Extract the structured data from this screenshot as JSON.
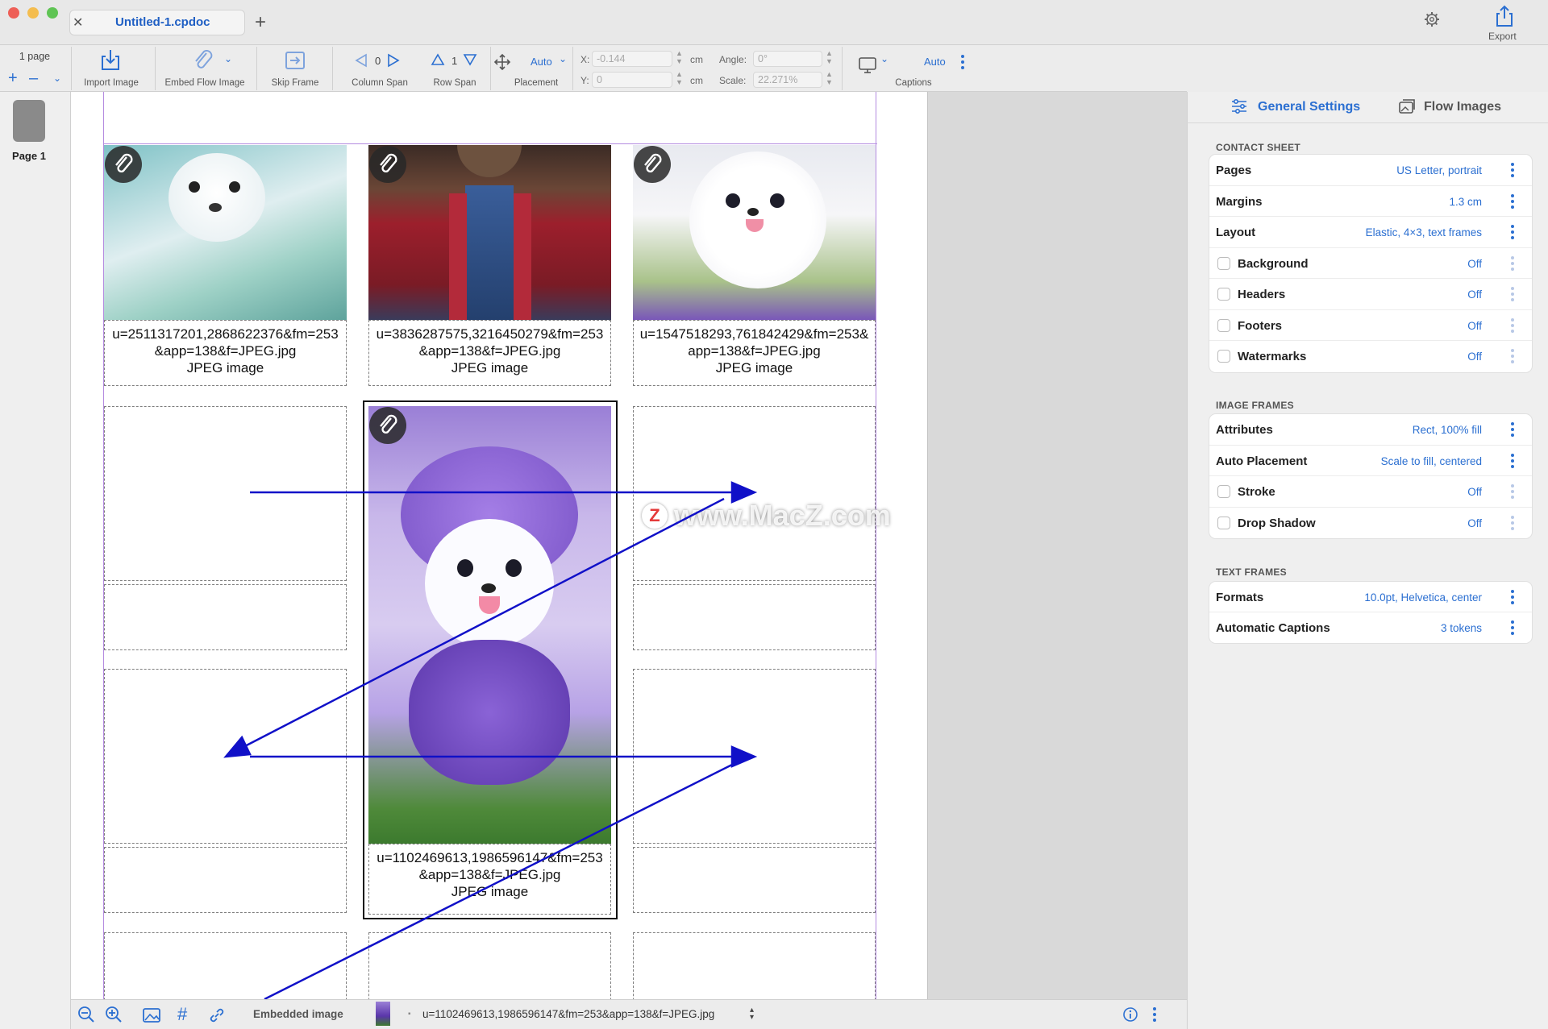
{
  "window": {
    "tab_title": "Untitled-1.cpdoc",
    "export_label": "Export"
  },
  "toolbar": {
    "page_count": "1 page",
    "import_image": "Import Image",
    "embed_flow_image": "Embed Flow Image",
    "skip_frame": "Skip Frame",
    "column_span_value": "0",
    "column_span": "Column Span",
    "row_span_value": "1",
    "row_span": "Row Span",
    "placement_value": "Auto",
    "placement": "Placement",
    "x_label": "X:",
    "x_value": "-0.144",
    "y_label": "Y:",
    "y_value": "0",
    "unit": "cm",
    "angle_label": "Angle:",
    "angle_value": "0°",
    "scale_label": "Scale:",
    "scale_value": "22.271%",
    "captions_value": "Auto",
    "captions": "Captions"
  },
  "pages": {
    "page1_label": "Page 1"
  },
  "canvas": {
    "captions": [
      {
        "line1": "u=2511317201,2868622376&fm=253",
        "line2": "&app=138&f=JPEG.jpg",
        "line3": "JPEG image"
      },
      {
        "line1": "u=3836287575,3216450279&fm=253",
        "line2": "&app=138&f=JPEG.jpg",
        "line3": "JPEG image"
      },
      {
        "line1": "u=1547518293,761842429&fm=253&",
        "line2": "app=138&f=JPEG.jpg",
        "line3": "JPEG image"
      },
      {
        "line1": "u=1102469613,1986596147&fm=253",
        "line2": "&app=138&f=JPEG.jpg",
        "line3": "JPEG image"
      }
    ],
    "watermark": "www.MacZ.com"
  },
  "bottombar": {
    "mode": "Embedded image",
    "filename": "u=1102469613,1986596147&fm=253&app=138&f=JPEG.jpg"
  },
  "panel": {
    "tab_general": "General Settings",
    "tab_flow": "Flow Images",
    "contact_sheet": {
      "title": "CONTACT SHEET",
      "rows": [
        {
          "label": "Pages",
          "value": "US Letter, portrait"
        },
        {
          "label": "Margins",
          "value": "1.3 cm"
        },
        {
          "label": "Layout",
          "value": "Elastic, 4×3, text frames"
        },
        {
          "label": "Background",
          "value": "Off"
        },
        {
          "label": "Headers",
          "value": "Off"
        },
        {
          "label": "Footers",
          "value": "Off"
        },
        {
          "label": "Watermarks",
          "value": "Off"
        }
      ]
    },
    "image_frames": {
      "title": "IMAGE FRAMES",
      "rows": [
        {
          "label": "Attributes",
          "value": "Rect, 100% fill"
        },
        {
          "label": "Auto Placement",
          "value": "Scale to fill, centered"
        },
        {
          "label": "Stroke",
          "value": "Off"
        },
        {
          "label": "Drop Shadow",
          "value": "Off"
        }
      ]
    },
    "text_frames": {
      "title": "TEXT FRAMES",
      "rows": [
        {
          "label": "Formats",
          "value": "10.0pt, Helvetica, center"
        },
        {
          "label": "Automatic Captions",
          "value": "3 tokens"
        }
      ]
    }
  },
  "colors": {
    "accent": "#2b6fd1",
    "flow_arrow": "#1010c8",
    "margin_guide": "#a070d0"
  }
}
